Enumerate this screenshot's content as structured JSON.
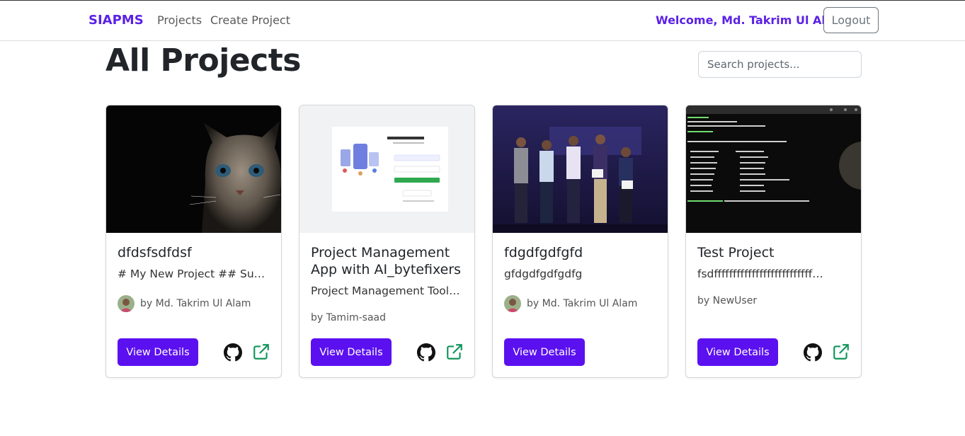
{
  "nav": {
    "brand": "SIAPMS",
    "links": [
      "Projects",
      "Create Project"
    ],
    "welcome": "Welcome, Md. Takrim Ul Alam",
    "logout": "Logout"
  },
  "page": {
    "title": "All Projects",
    "search_placeholder": "Search projects..."
  },
  "cards": [
    {
      "title": "dfdsfsdfdsf",
      "description": "# My New Project ## Supp…",
      "author": "by Md. Takrim Ul Alam",
      "has_avatar": true,
      "button": "View Details"
    },
    {
      "title": "Project Management App with AI_bytefixers",
      "description": "Project Management Tool …",
      "author": "by Tamim-saad",
      "has_avatar": false,
      "button": "View Details"
    },
    {
      "title": "fdgdfgdfgfd",
      "description": "gfdgdfgdfgdfg",
      "author": "by Md. Takrim Ul Alam",
      "has_avatar": true,
      "button": "View Details"
    },
    {
      "title": "Test Project",
      "description": "fsdffffffffffffffffffffffffff…",
      "author": "by NewUser",
      "has_avatar": false,
      "button": "View Details"
    }
  ],
  "icons": {
    "github": "github-icon",
    "external": "external-link-icon"
  },
  "colors": {
    "brand": "#5b21e6",
    "button": "#5b10f0",
    "external_icon": "#13955a"
  }
}
